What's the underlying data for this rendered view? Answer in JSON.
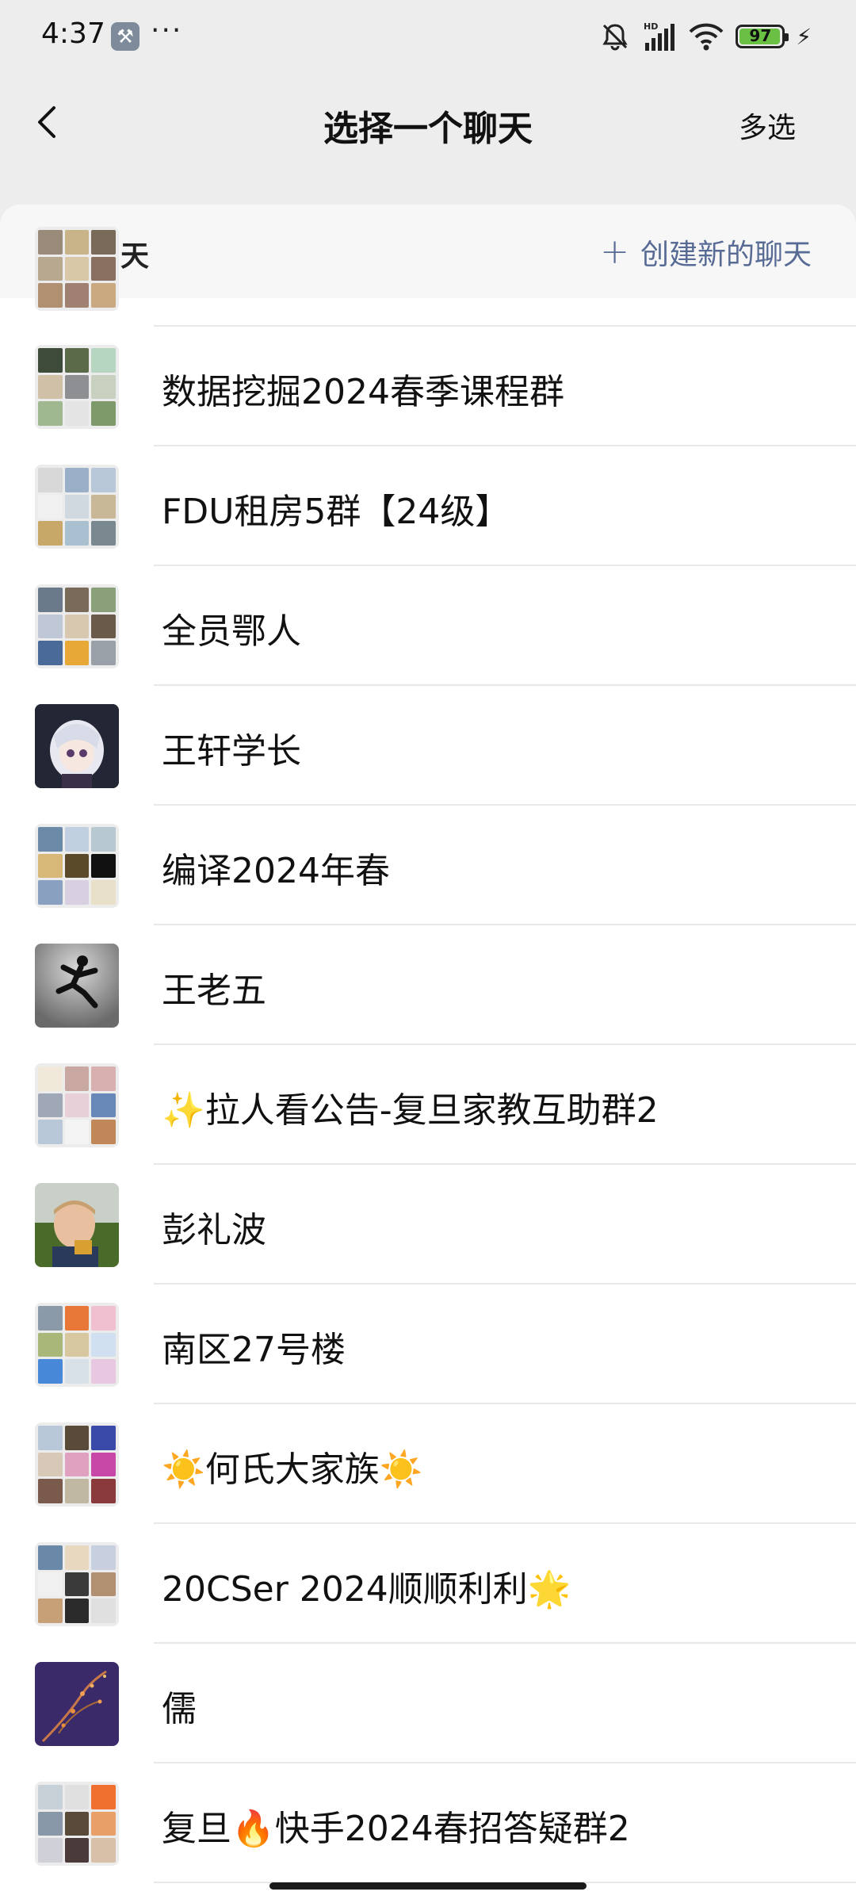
{
  "status": {
    "time": "4:37",
    "battery": "97"
  },
  "header": {
    "title": "选择一个聊天",
    "multi_select": "多选"
  },
  "section": {
    "title": "最近聊天",
    "create_new": "创建新的聊天"
  },
  "chats": [
    {
      "name": "数据挖掘2024春季课程群"
    },
    {
      "name": "FDU租房5群【24级】"
    },
    {
      "name": "全员鄂人"
    },
    {
      "name": "王轩学长"
    },
    {
      "name": "编译2024年春"
    },
    {
      "name": "王老五"
    },
    {
      "name": "✨拉人看公告-复旦家教互助群2"
    },
    {
      "name": "彭礼波"
    },
    {
      "name": "南区27号楼"
    },
    {
      "name": "☀️何氏大家族☀️"
    },
    {
      "name": "20CSer 2024顺顺利利🌟"
    },
    {
      "name": "儒"
    },
    {
      "name": "复旦🔥快手2024春招答疑群2"
    }
  ]
}
